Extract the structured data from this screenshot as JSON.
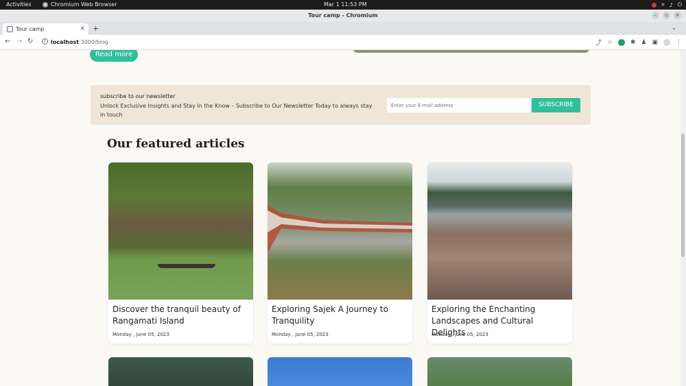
{
  "system_bar": {
    "activities": "Activities",
    "app_name": "Chromium Web Browser",
    "clock": "Mar 1  11:53 PM"
  },
  "window": {
    "title": "Tour camp - Chromium"
  },
  "tabs": [
    {
      "title": "Tour camp",
      "close": "×"
    }
  ],
  "newtab_label": "+",
  "omnibox": {
    "host": "localhost",
    "path": ":3000/blog"
  },
  "page": {
    "read_more": "Read more",
    "newsletter": {
      "title": "subscribe to our newsletter",
      "description": "Unlock Exclusive Insights and Stay In the Know – Subscribe to Our Newsletter Today to always stay in touch",
      "email_placeholder": "Enter your E-mail address",
      "button": "SUBSCRIBE"
    },
    "featured_title": "Our featured articles",
    "articles": [
      {
        "title": "Discover the tranquil beauty of Rangamati Island",
        "date": "Monday , june 05, 2023"
      },
      {
        "title": "Exploring Sajek A Journey to Tranquility",
        "date": "Monday , june 05, 2023"
      },
      {
        "title": "Exploring the Enchanting Landscapes and Cultural Delights",
        "date": "Monday , june 05, 2023"
      }
    ]
  },
  "colors": {
    "accent": "#2fbf9a",
    "page_bg": "#fbf9f4",
    "newsletter_bg": "#efe6d9"
  }
}
